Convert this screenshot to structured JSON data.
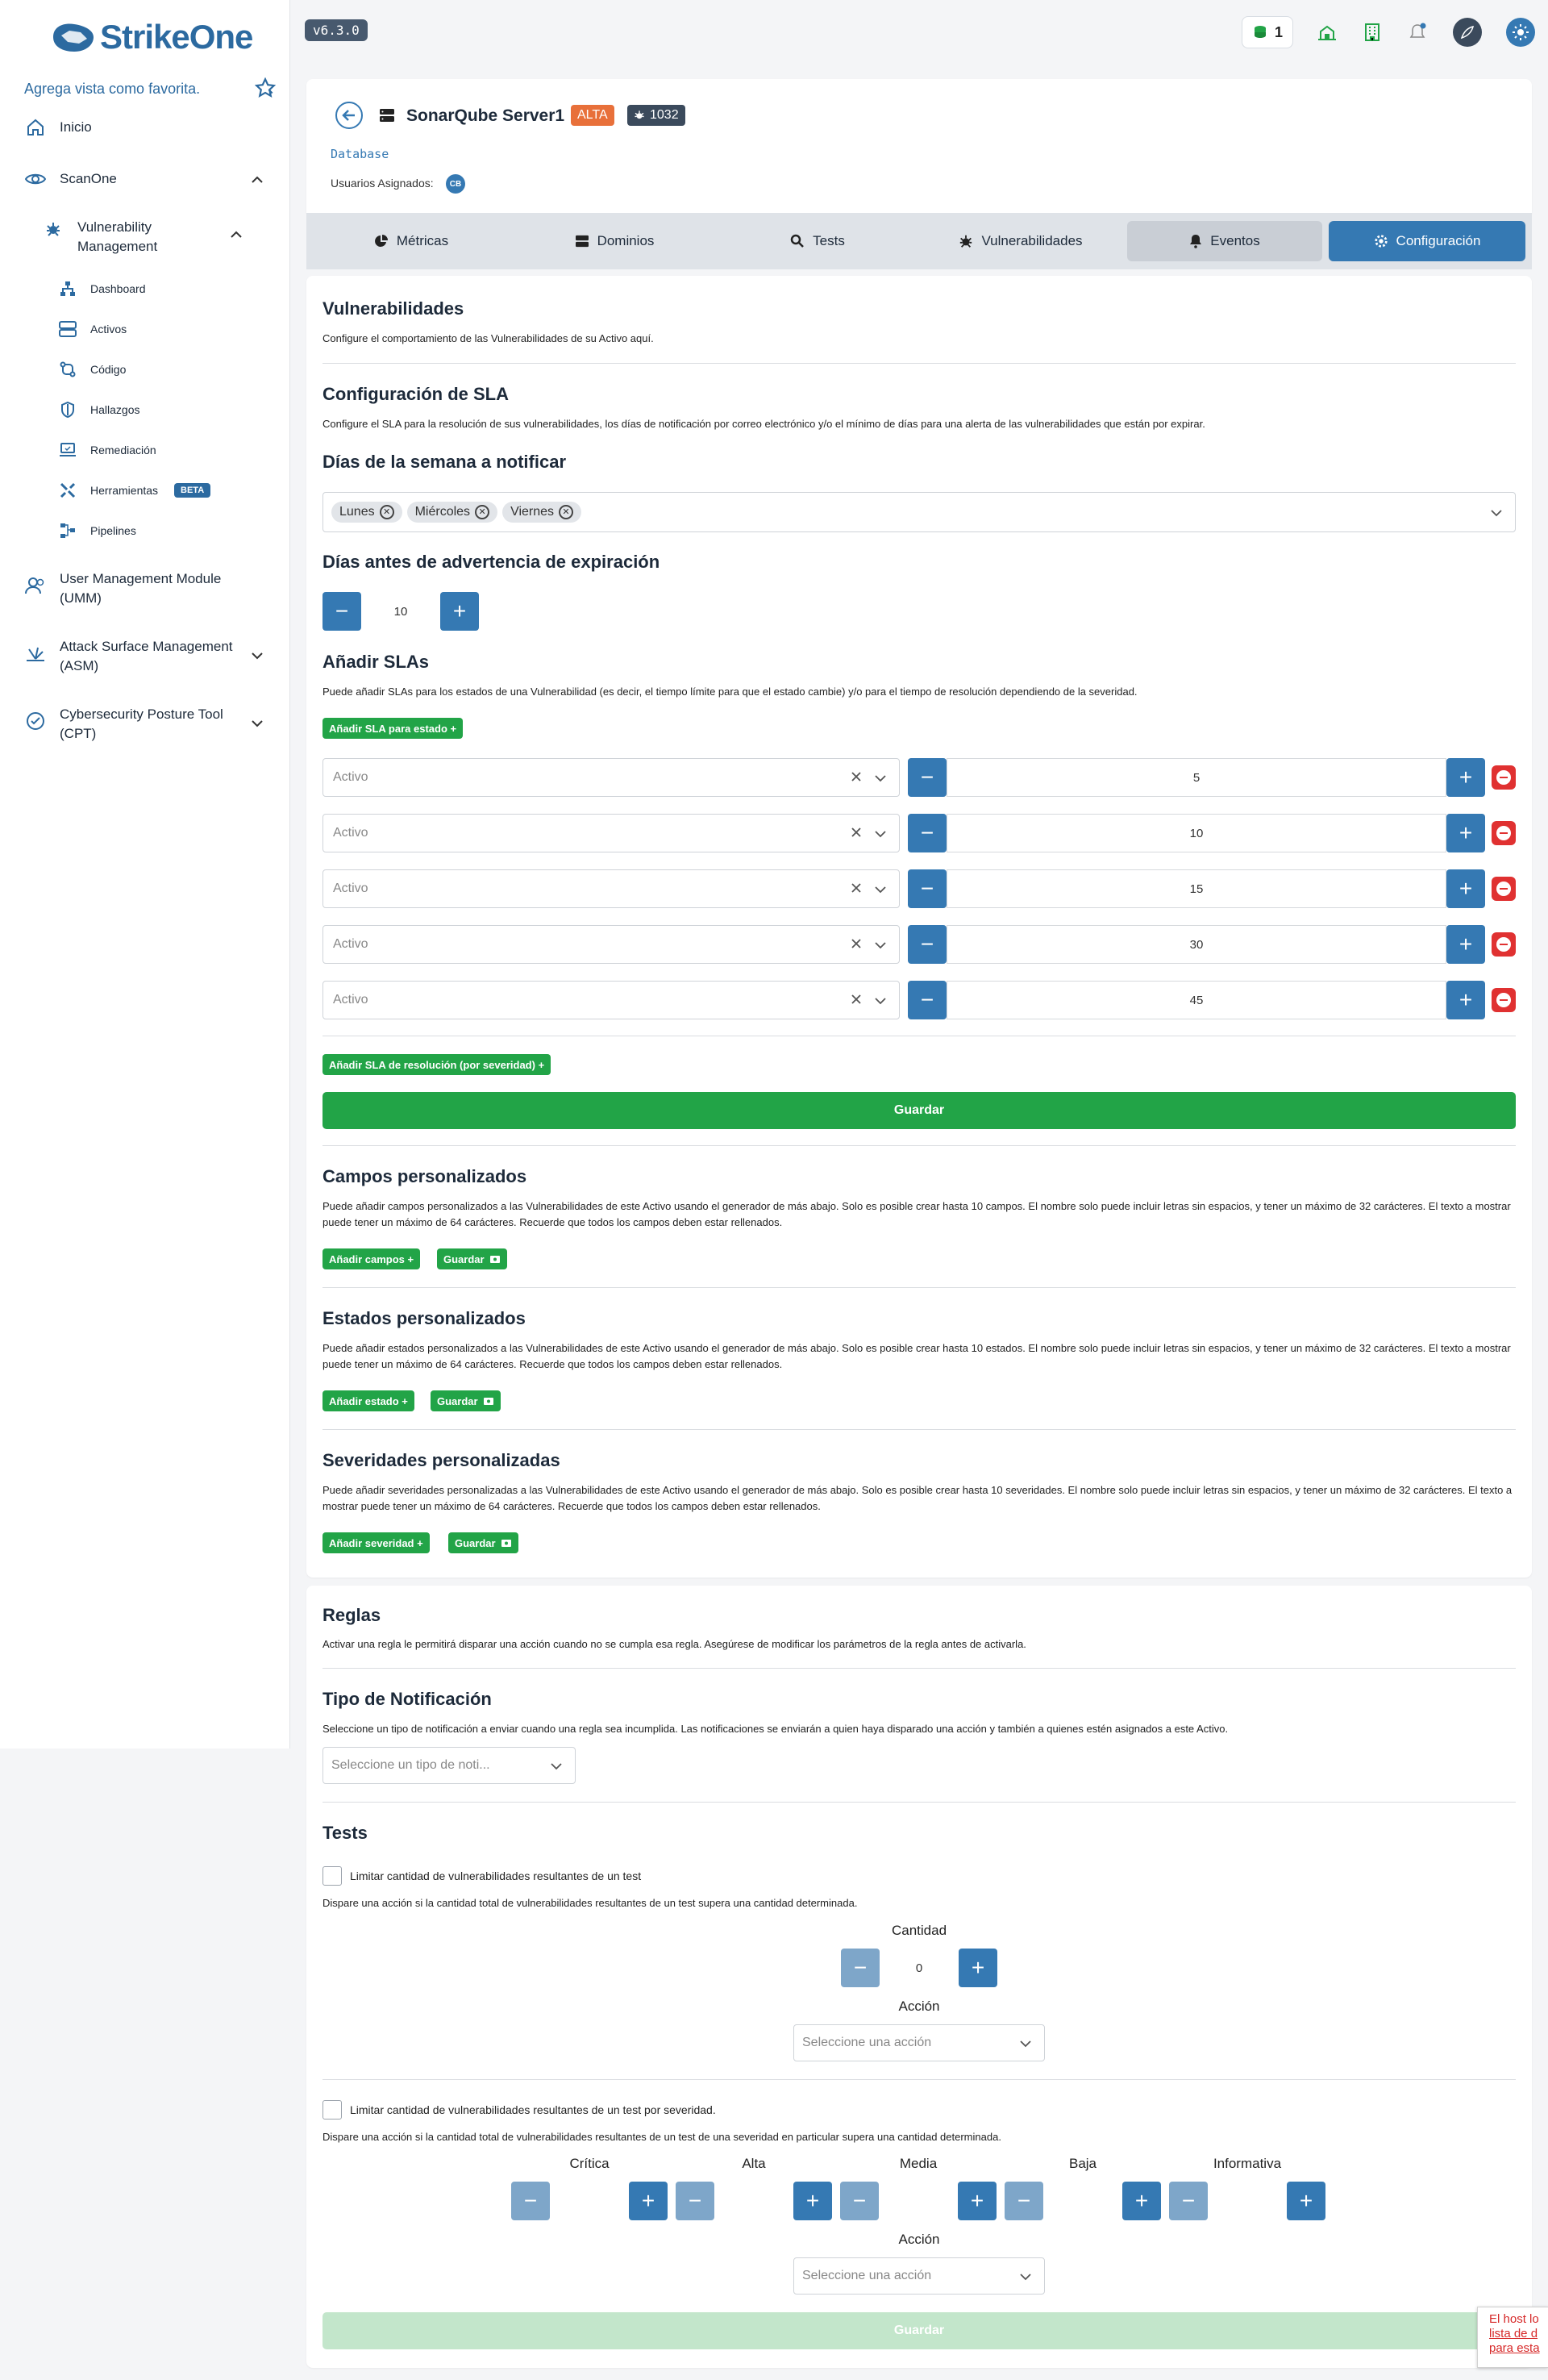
{
  "app": {
    "brand": "StrikeOne",
    "version": "v6.3.0",
    "favorite_hint": "Agrega vista como favorita.",
    "coins": "1"
  },
  "sidebar": {
    "inicio": "Inicio",
    "scanone": "ScanOne",
    "vm_line1": "Vulnerability",
    "vm_line2": "Management",
    "sub": [
      {
        "label": "Dashboard",
        "icon": "sitemap-icon"
      },
      {
        "label": "Activos",
        "icon": "server-icon"
      },
      {
        "label": "Código",
        "icon": "code-branch-icon"
      },
      {
        "label": "Hallazgos",
        "icon": "shield-icon"
      },
      {
        "label": "Remediación",
        "icon": "laptop-icon"
      },
      {
        "label": "Herramientas",
        "icon": "tools-icon",
        "badge": "BETA"
      },
      {
        "label": "Pipelines",
        "icon": "pipeline-icon"
      }
    ],
    "umm_line1": "User Management Module",
    "umm_line2": "(UMM)",
    "asm_line1": "Attack Surface Management",
    "asm_line2": "(ASM)",
    "cpt_line1": "Cybersecurity Posture Tool",
    "cpt_line2": "(CPT)"
  },
  "asset": {
    "name": "SonarQube Server1",
    "severity_badge": "ALTA",
    "vuln_count": "1032",
    "type": "Database",
    "assigned_label": "Usuarios Asignados:",
    "assigned_initials": "CB"
  },
  "tabs": [
    "Métricas",
    "Dominios",
    "Tests",
    "Vulnerabilidades",
    "Eventos",
    "Configuración"
  ],
  "vuln": {
    "title": "Vulnerabilidades",
    "desc": "Configure el comportamiento de las Vulnerabilidades de su Activo aquí."
  },
  "sla": {
    "title": "Configuración de SLA",
    "desc": "Configure el SLA para la resolución de sus vulnerabilidades, los días de notificación por correo electrónico y/o el mínimo de días para una alerta de las vulnerabilidades que están por expirar.",
    "days_title": "Días de la semana a notificar",
    "days": [
      "Lunes",
      "Miércoles",
      "Viernes"
    ],
    "warn_title": "Días antes de advertencia de expiración",
    "warn_value": "10",
    "add_title": "Añadir SLAs",
    "add_desc": "Puede añadir SLAs para los estados de una Vulnerabilidad (es decir, el tiempo límite para que el estado cambie) y/o para el tiempo de resolución dependiendo de la severidad.",
    "add_state_btn": "Añadir SLA para estado +",
    "rows": [
      {
        "state": "Activo",
        "value": "5"
      },
      {
        "state": "Activo",
        "value": "10"
      },
      {
        "state": "Activo",
        "value": "15"
      },
      {
        "state": "Activo",
        "value": "30"
      },
      {
        "state": "Activo",
        "value": "45"
      }
    ],
    "add_resolution_btn": "Añadir SLA de resolución (por severidad) +",
    "save": "Guardar"
  },
  "custom_fields": {
    "title": "Campos personalizados",
    "desc": "Puede añadir campos personalizados a las Vulnerabilidades de este Activo usando el generador de más abajo. Solo es posible crear hasta 10 campos. El nombre solo puede incluir letras sin espacios, y tener un máximo de 32 carácteres. El texto a mostrar puede tener un máximo de 64 carácteres. Recuerde que todos los campos deben estar rellenados.",
    "add_btn": "Añadir campos +",
    "save_btn": "Guardar"
  },
  "custom_states": {
    "title": "Estados personalizados",
    "desc": "Puede añadir estados personalizados a las Vulnerabilidades de este Activo usando el generador de más abajo. Solo es posible crear hasta 10 estados. El nombre solo puede incluir letras sin espacios, y tener un máximo de 32 carácteres. El texto a mostrar puede tener un máximo de 64 carácteres. Recuerde que todos los campos deben estar rellenados.",
    "add_btn": "Añadir estado +",
    "save_btn": "Guardar"
  },
  "custom_severities": {
    "title": "Severidades personalizadas",
    "desc": "Puede añadir severidades personalizadas a las Vulnerabilidades de este Activo usando el generador de más abajo. Solo es posible crear hasta 10 severidades. El nombre solo puede incluir letras sin espacios, y tener un máximo de 32 carácteres. El texto a mostrar puede tener un máximo de 64 carácteres. Recuerde que todos los campos deben estar rellenados.",
    "add_btn": "Añadir severidad +",
    "save_btn": "Guardar"
  },
  "rules": {
    "title": "Reglas",
    "desc": "Activar una regla le permitirá disparar una acción cuando no se cumpla esa regla. Asegúrese de modificar los parámetros de la regla antes de activarla.",
    "notif_title": "Tipo de Notificación",
    "notif_desc": "Seleccione un tipo de notificación a enviar cuando una regla sea incumplida. Las notificaciones se enviarán a quien haya disparado una acción y también a quienes estén asignados a este Activo.",
    "notif_placeholder": "Seleccione un tipo de noti..."
  },
  "tests": {
    "title": "Tests",
    "limit_label": "Limitar cantidad de vulnerabilidades resultantes de un test",
    "limit_desc": "Dispare una acción si la cantidad total de vulnerabilidades resultantes de un test supera una cantidad determinada.",
    "cantidad_label": "Cantidad",
    "cantidad_value": "0",
    "accion_label": "Acción",
    "accion_placeholder": "Seleccione una acción",
    "sev_limit_label": "Limitar cantidad de vulnerabilidades resultantes de un test por severidad.",
    "sev_limit_desc": "Dispare una acción si la cantidad total de vulnerabilidades resultantes de un test de una severidad en particular supera una cantidad determinada.",
    "severities": [
      "Crítica",
      "Alta",
      "Media",
      "Baja",
      "Informativa"
    ],
    "accion2_label": "Acción",
    "accion2_placeholder": "Seleccione una acción",
    "save": "Guardar"
  },
  "toast": {
    "line1": "El host lo",
    "line2": "lista de d",
    "line3": "para esta"
  },
  "colors": {
    "primary": "#3579b3",
    "success": "#22a447",
    "danger": "#e03131",
    "alta": "#e8703a"
  }
}
